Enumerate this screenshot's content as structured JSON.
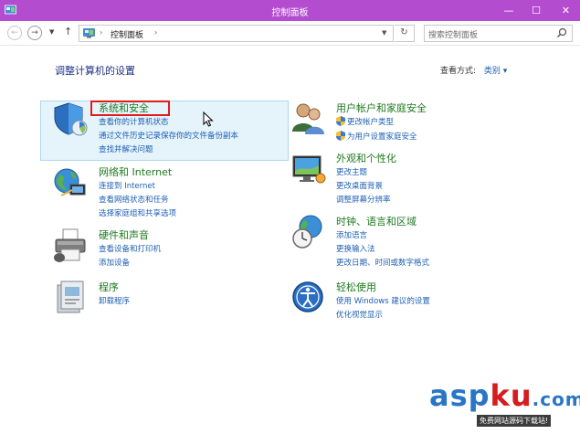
{
  "window": {
    "title": "控制面板",
    "controls": {
      "minimize": "—",
      "maximize": "☐",
      "close": "✕"
    }
  },
  "navbar": {
    "breadcrumb": "控制面板",
    "separator": "›",
    "search_placeholder": "搜索控制面板",
    "refresh": "↻"
  },
  "main": {
    "heading": "调整计算机的设置",
    "view_by_label": "查看方式:",
    "view_by_value": "类别 ▾"
  },
  "categories": {
    "system_security": {
      "title": "系统和安全",
      "links": [
        "查看你的计算机状态",
        "通过文件历史记录保存你的文件备份副本",
        "查找并解决问题"
      ]
    },
    "network": {
      "title": "网络和 Internet",
      "links": [
        "连接到 Internet",
        "查看网络状态和任务",
        "选择家庭组和共享选项"
      ]
    },
    "hardware": {
      "title": "硬件和声音",
      "links": [
        "查看设备和打印机",
        "添加设备"
      ]
    },
    "programs": {
      "title": "程序",
      "links": [
        "卸载程序"
      ]
    },
    "user_accounts": {
      "title": "用户帐户和家庭安全",
      "links": [
        "更改帐户类型",
        "为用户设置家庭安全"
      ]
    },
    "appearance": {
      "title": "外观和个性化",
      "links": [
        "更改主题",
        "更改桌面背景",
        "调整屏幕分辨率"
      ]
    },
    "clock_region": {
      "title": "时钟、语言和区域",
      "links": [
        "添加语言",
        "更换输入法",
        "更改日期、时间或数字格式"
      ]
    },
    "ease_of_access": {
      "title": "轻松使用",
      "links": [
        "使用 Windows 建议的设置",
        "优化视觉显示"
      ]
    }
  },
  "watermark": {
    "brand_asp": "asp",
    "brand_ku": "ku",
    "brand_tld": ".com",
    "tagline": "免费网站源码下载站!"
  },
  "colors": {
    "titlebar": "#b44ccf",
    "category_title": "#1e7a1e",
    "link": "#1e5fb4",
    "heading": "#1e3287",
    "highlight": "#e5f3fb",
    "annotation_box": "#e11b1b"
  }
}
